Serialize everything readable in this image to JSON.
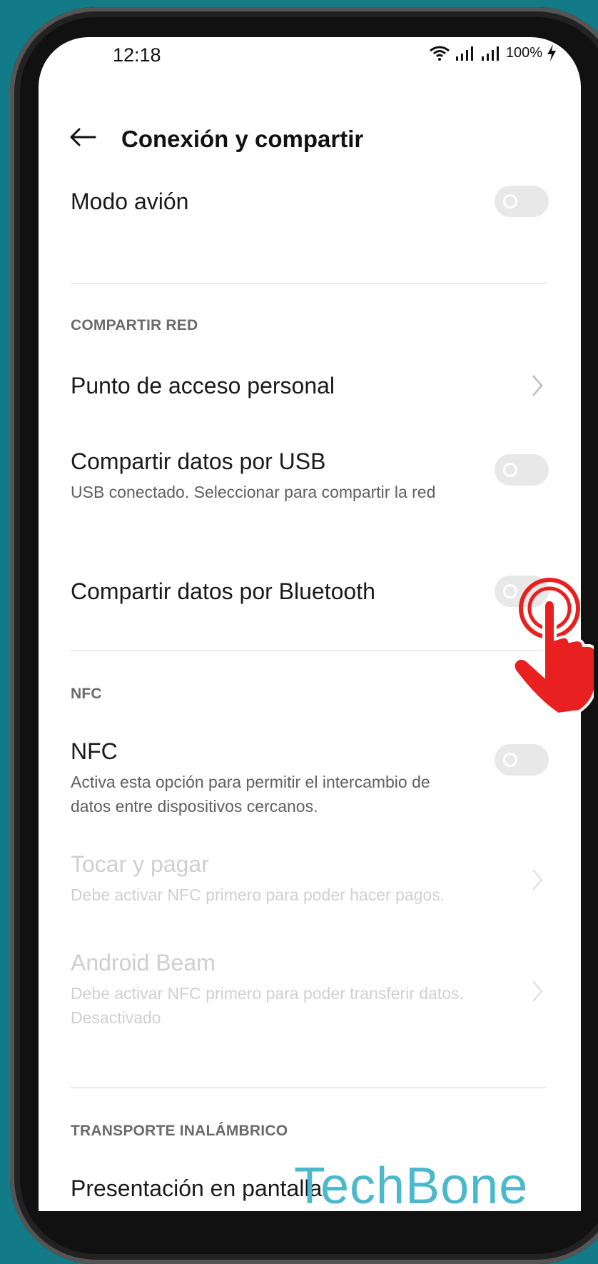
{
  "status": {
    "time": "12:18",
    "battery": "100%"
  },
  "header": {
    "title": "Conexión y compartir"
  },
  "airplane": {
    "label": "Modo avión"
  },
  "sections": {
    "compartir_red": "COMPARTIR RED",
    "nfc": "NFC",
    "transporte": "TRANSPORTE INALÁMBRICO"
  },
  "items": {
    "hotspot": {
      "label": "Punto de acceso personal"
    },
    "usb": {
      "label": "Compartir datos por USB",
      "sub": "USB conectado. Seleccionar para compartir la red"
    },
    "bluetooth": {
      "label": "Compartir datos por Bluetooth"
    },
    "nfc": {
      "label": "NFC",
      "sub": "Activa esta opción para permitir el intercambio de datos entre dispositivos cercanos."
    },
    "tap_pay": {
      "label": "Tocar y pagar",
      "sub": "Debe activar NFC primero para poder hacer pagos."
    },
    "android_beam": {
      "label": "Android Beam",
      "sub": "Debe activar NFC primero para poder transferir datos.",
      "status": "Desactivado"
    },
    "screen_cast": {
      "label": "Presentación en pantalla"
    }
  },
  "watermark": "TechBone",
  "colors": {
    "background": "#137a88",
    "watermark": "#4bb9cb",
    "hand": "#e8201f"
  }
}
